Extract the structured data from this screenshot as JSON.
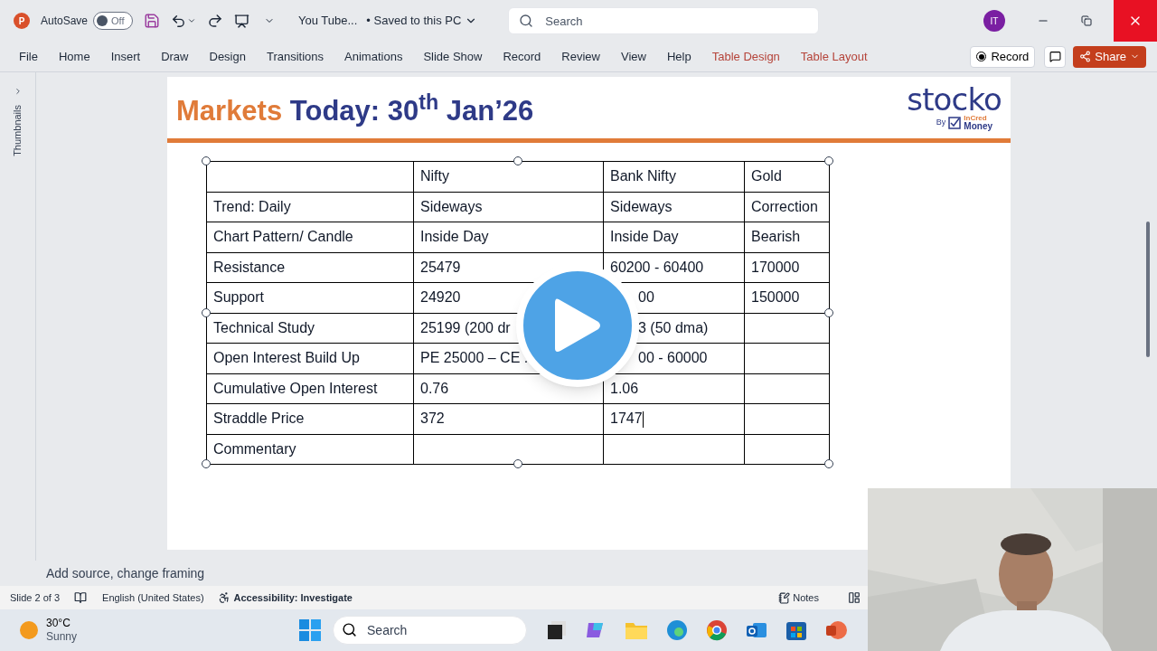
{
  "title_bar": {
    "app_letter": "P",
    "autosave_label": "AutoSave",
    "autosave": {
      "on": false,
      "label": "Off"
    },
    "doc_title": "You Tube...",
    "save_status": "• Saved to this PC",
    "search": {
      "placeholder": "Search"
    },
    "avatar": "IT"
  },
  "ribbon": {
    "tabs": [
      {
        "label": "File",
        "kind": "standard"
      },
      {
        "label": "Home",
        "kind": "standard"
      },
      {
        "label": "Insert",
        "kind": "standard"
      },
      {
        "label": "Draw",
        "kind": "standard"
      },
      {
        "label": "Design",
        "kind": "standard"
      },
      {
        "label": "Transitions",
        "kind": "standard"
      },
      {
        "label": "Animations",
        "kind": "standard"
      },
      {
        "label": "Slide Show",
        "kind": "standard"
      },
      {
        "label": "Record",
        "kind": "standard"
      },
      {
        "label": "Review",
        "kind": "standard"
      },
      {
        "label": "View",
        "kind": "standard"
      },
      {
        "label": "Help",
        "kind": "standard"
      },
      {
        "label": "Table Design",
        "kind": "contextual"
      },
      {
        "label": "Table Layout",
        "kind": "contextual"
      }
    ],
    "record_button": "Record",
    "share_button": "Share"
  },
  "thumbnails_pane": {
    "label": "Thumbnails"
  },
  "slide": {
    "title_highlight": "Markets",
    "title_rest": "Today: 30$^{th}$ Jan’26",
    "logo": {
      "name": "stocko",
      "by": "By",
      "brand_top": "InCred",
      "brand_bottom": "Money"
    },
    "table": {
      "rows": [
        [
          {
            "text": ""
          },
          {
            "text": "Nifty"
          },
          {
            "text": "Bank Nifty"
          },
          {
            "text": "Gold"
          }
        ],
        [
          {
            "text": "Trend: Daily"
          },
          {
            "text": "Sideways"
          },
          {
            "text": "Sideways"
          },
          {
            "text": "Correction"
          }
        ],
        [
          {
            "text": "Chart Pattern/ Candle"
          },
          {
            "text": "Inside Day"
          },
          {
            "text": "Inside Day"
          },
          {
            "text": "Bearish"
          }
        ],
        [
          {
            "text": "Resistance"
          },
          {
            "text": "25479"
          },
          {
            "text": "60200 - 60400"
          },
          {
            "text": "170000"
          }
        ],
        [
          {
            "text": "Support"
          },
          {
            "text": "24920"
          },
          {
            "text": "00",
            "covered": true
          },
          {
            "text": "150000"
          }
        ],
        [
          {
            "text": "Technical Study"
          },
          {
            "text": "25199 (200 dr"
          },
          {
            "text": "3 (50 dma)",
            "covered": true
          },
          {
            "text": ""
          }
        ],
        [
          {
            "text": "Open Interest Build Up"
          },
          {
            "text": "PE 25000 – CE ."
          },
          {
            "text": "00 - 60000",
            "covered": true
          },
          {
            "text": ""
          }
        ],
        [
          {
            "text": "Cumulative Open Interest"
          },
          {
            "text": "0.76"
          },
          {
            "text": "1.06"
          },
          {
            "text": ""
          }
        ],
        [
          {
            "text": "Straddle Price"
          },
          {
            "text": "372"
          },
          {
            "text": "1747",
            "cursor": true
          },
          {
            "text": ""
          }
        ],
        [
          {
            "text": "Commentary"
          },
          {
            "text": ""
          },
          {
            "text": ""
          },
          {
            "text": ""
          }
        ]
      ]
    }
  },
  "notes_hint": "Add source, change framing",
  "status_bar": {
    "slide": "Slide 2 of 3",
    "language": "English (United States)",
    "accessibility": "Accessibility: Investigate",
    "notes": "Notes"
  },
  "taskbar": {
    "weather": {
      "temp": "30°C",
      "condition": "Sunny"
    },
    "search": {
      "placeholder": "Search"
    }
  }
}
